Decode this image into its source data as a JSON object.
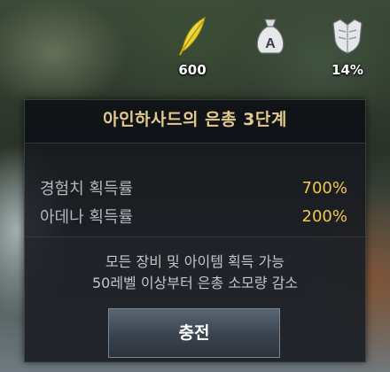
{
  "hud": {
    "feather": {
      "icon": "golden-feather-icon",
      "value": "600"
    },
    "adena": {
      "icon": "adena-bag-icon",
      "badge": "A"
    },
    "armor": {
      "icon": "armor-icon",
      "value": "14%"
    }
  },
  "popup": {
    "title": "아인하사드의 은총 3단계",
    "stats": [
      {
        "label": "경험치 획득률",
        "value": "700%"
      },
      {
        "label": "아데나 획득률",
        "value": "200%"
      }
    ],
    "notes": [
      "모든 장비 및 아이템 획득 가능",
      "50레벨 이상부터 은총 소모량 감소"
    ],
    "charge_button": "충전"
  },
  "colors": {
    "title": "#e3c98d",
    "value": "#f2c84e"
  }
}
